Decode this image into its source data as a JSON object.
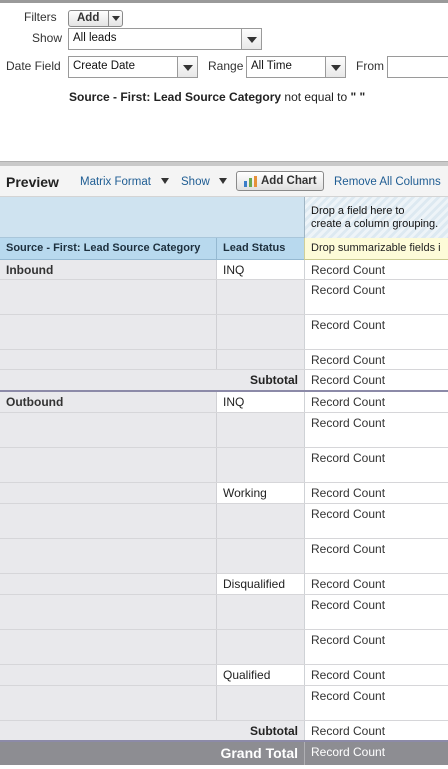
{
  "filters": {
    "filters_label": "Filters",
    "add_label": "Add",
    "show_label": "Show",
    "show_value": "All leads",
    "date_field_label": "Date Field",
    "date_field_value": "Create Date",
    "range_label": "Range",
    "range_value": "All Time",
    "from_label": "From",
    "from_value": "",
    "active_filter": {
      "field": "Source - First: Lead Source Category",
      "operator": "not equal to",
      "value": "\" \""
    }
  },
  "preview": {
    "title": "Preview",
    "matrix_format": "Matrix Format",
    "show": "Show",
    "add_chart": "Add Chart",
    "remove_all_columns": "Remove All Columns"
  },
  "grid": {
    "drop_column_line1": "Drop a field here to",
    "drop_column_line2": "create a column grouping.",
    "col_source": "Source - First: Lead Source Category",
    "col_status": "Lead Status",
    "drop_summarizable": "Drop summarizable fields i",
    "record_count": "Record Count",
    "subtotal": "Subtotal",
    "grand_total": "Grand Total",
    "groups": [
      {
        "name": "Inbound",
        "statuses": [
          "INQ"
        ]
      },
      {
        "name": "Outbound",
        "statuses": [
          "INQ",
          "Working",
          "Disqualified",
          "Qualified"
        ]
      }
    ]
  },
  "colors": {
    "link": "#1f5d93",
    "header_blue": "#b8d9ee",
    "drop_yellow": "#fdfbd8",
    "grand_total_bg": "#8d8d92"
  }
}
